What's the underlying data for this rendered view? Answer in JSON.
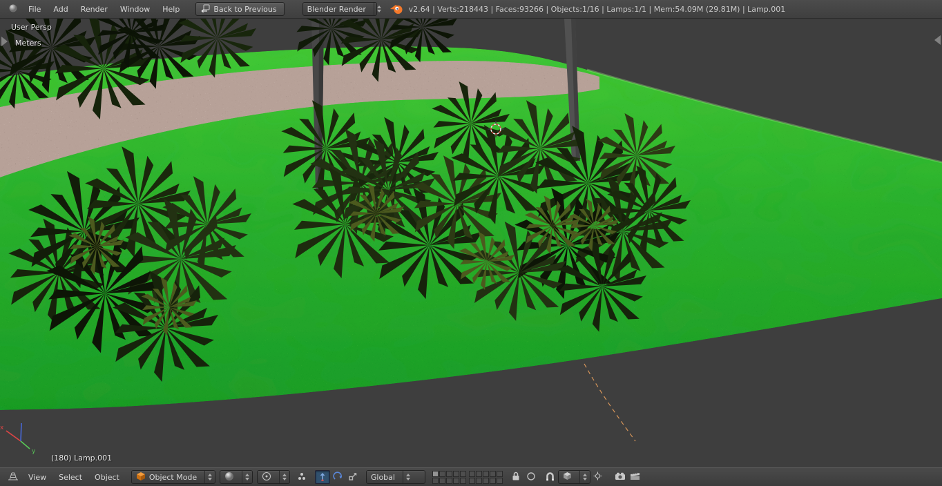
{
  "topbar": {
    "menus": [
      "File",
      "Add",
      "Render",
      "Window",
      "Help"
    ],
    "back_button": "Back to Previous",
    "engine": "Blender Render",
    "stats": "v2.64 | Verts:218443 | Faces:93266 | Objects:1/16 | Lamps:1/1 | Mem:54.09M (29.81M) | Lamp.001"
  },
  "viewport": {
    "view_label": "User Persp",
    "unit_label": "Meters",
    "active_object": "(180) Lamp.001",
    "axis_labels": {
      "x": "x",
      "y": "y"
    }
  },
  "bottombar": {
    "menus": [
      "View",
      "Select",
      "Object"
    ],
    "mode": "Object Mode",
    "orientation": "Global",
    "active_layer": 1
  },
  "colors": {
    "grass_green": "#2eb42e",
    "gravel_pink": "#b7a198",
    "header_text": "#d8d8d8",
    "lamp_line_orange": "#d7965a",
    "selection_orange": "#f4792b",
    "axis_x_red": "#e04545",
    "axis_y_green": "#58c858",
    "axis_z_blue": "#4868d8"
  }
}
